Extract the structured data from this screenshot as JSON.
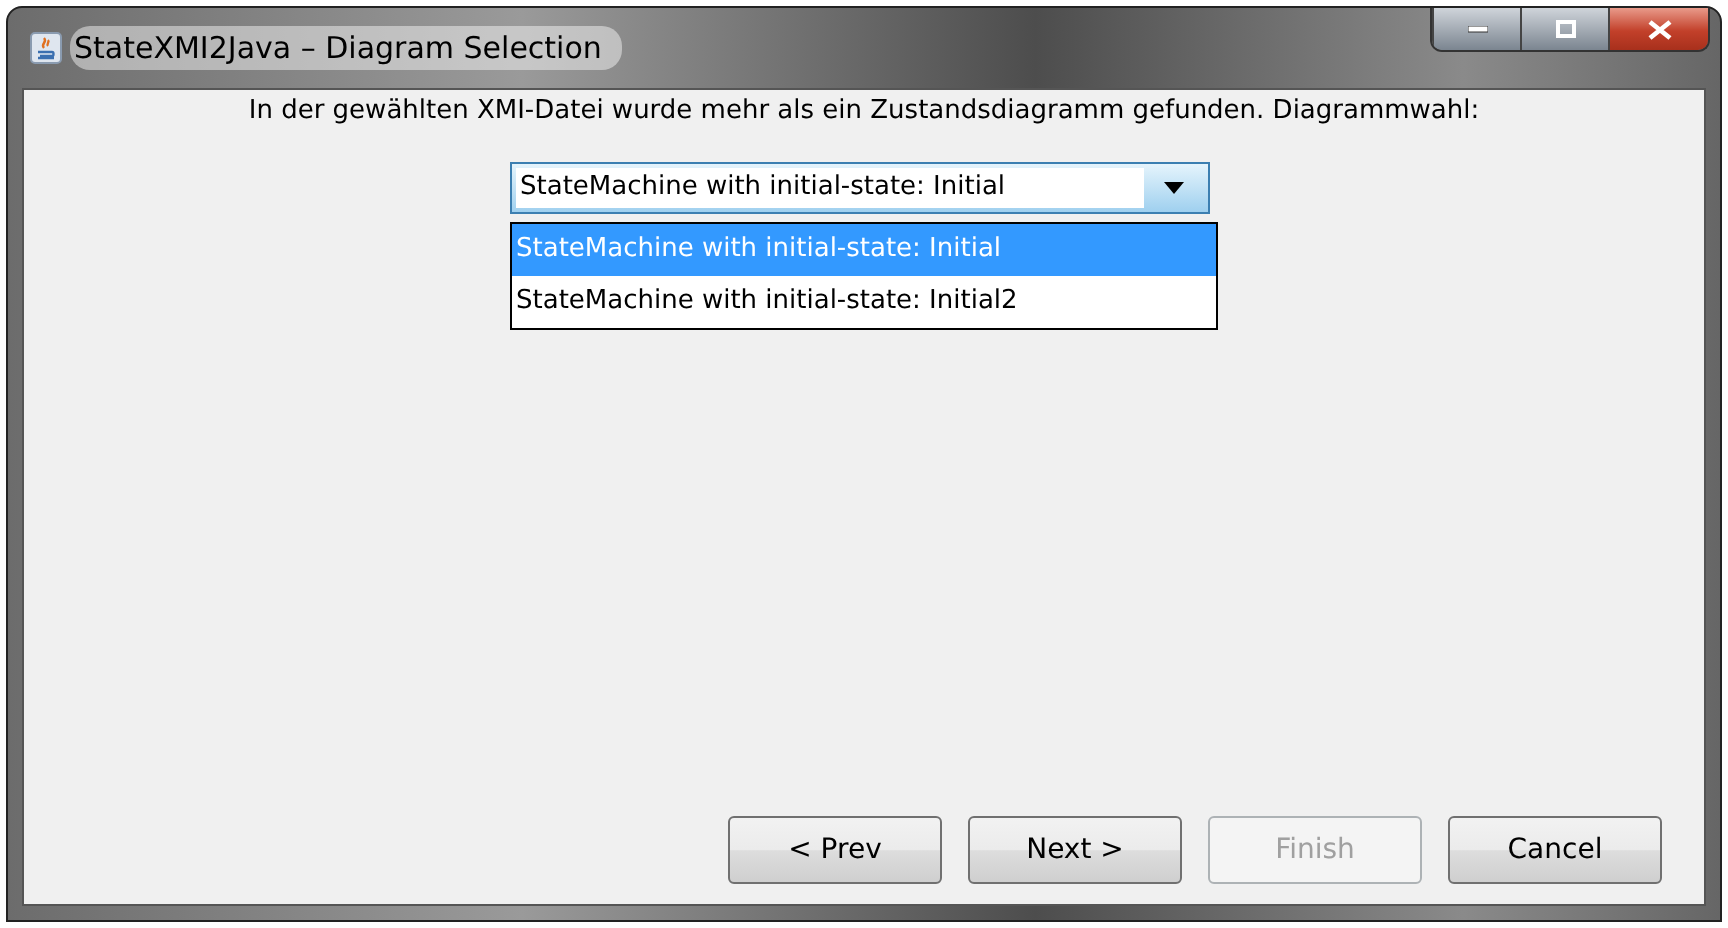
{
  "window": {
    "title": "StateXMI2Java – Diagram Selection"
  },
  "message": "In der gewählten XMI-Datei wurde mehr als ein Zustandsdiagramm gefunden.  Diagrammwahl:",
  "combo": {
    "value": "StateMachine with initial-state: Initial",
    "expanded": true,
    "options": [
      {
        "label": "StateMachine with initial-state: Initial",
        "selected": true
      },
      {
        "label": "StateMachine with initial-state: Initial2",
        "selected": false
      }
    ]
  },
  "buttons": [
    {
      "label": "< Prev",
      "disabled": false
    },
    {
      "label": "Next >",
      "disabled": false
    },
    {
      "label": "Finish",
      "disabled": true
    },
    {
      "label": "Cancel",
      "disabled": false
    }
  ]
}
